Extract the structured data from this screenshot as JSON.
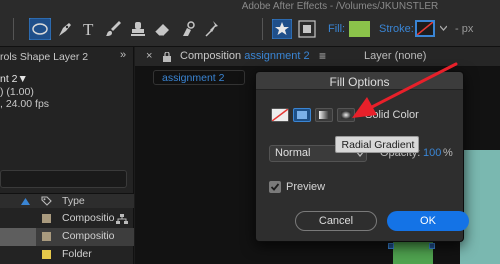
{
  "app": {
    "title": "Adobe After Effects - /Volumes/JKUNSTLER"
  },
  "toolbar": {
    "fill_label": "Fill:",
    "stroke_label": "Stroke:",
    "stroke_width_suffix": "- px",
    "fill_color": "#8bc34a",
    "stroke_none_color": "#e53935",
    "accent": "#1473e6"
  },
  "left_panel": {
    "header_title": "rols Shape Layer 2",
    "comp_name": "nt 2",
    "line1": ") (1.00)",
    "line2": ", 24.00 fps",
    "column_type_label": "Type",
    "rows": [
      {
        "label": "Compositio",
        "color": "#a99a7e",
        "selected": false
      },
      {
        "label": "Compositio",
        "color": "#a99a7e",
        "selected": true
      },
      {
        "label": "Folder",
        "color": "#e5c84a",
        "selected": false
      }
    ]
  },
  "comp_panel": {
    "tab_label": "Composition",
    "tab_name": "assignment 2",
    "layer_label": "Layer (none)",
    "chip_label": "assignment 2"
  },
  "dialog": {
    "title": "Fill Options",
    "fill_type_label": "Solid Color",
    "tooltip": "Radial Gradient",
    "blend_mode": "Normal",
    "opacity_label": "Opacity:",
    "opacity_value": "100",
    "opacity_unit": "%",
    "preview_label": "Preview",
    "cancel_label": "Cancel",
    "ok_label": "OK"
  },
  "annotation": {
    "arrow_color": "#e8202a"
  }
}
